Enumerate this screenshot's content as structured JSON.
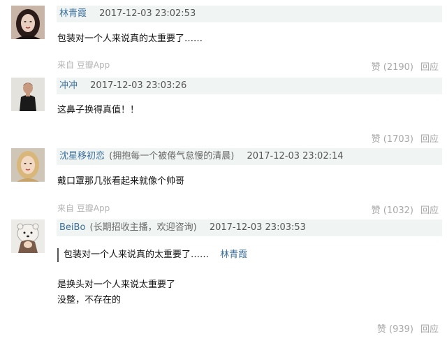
{
  "comments": [
    {
      "user": "林青霞",
      "signature": "",
      "time": "2017-12-03 23:02:53",
      "text_lines": [
        "包装对一个人来说真的太重要了……"
      ],
      "source": "来自 豆瓣App",
      "like_label": "赞 (2190)",
      "reply_label": "回应"
    },
    {
      "user": "冲冲",
      "signature": "",
      "time": "2017-12-03 23:03:26",
      "text_lines": [
        "这鼻子换得真值！！"
      ],
      "source": "",
      "like_label": "赞 (1703)",
      "reply_label": "回应"
    },
    {
      "user": "沈星移初恋",
      "signature": "(拥抱每一个被倦气怠慢的清晨)",
      "time": "2017-12-03 23:02:14",
      "text_lines": [
        "戴口罩那几张看起来就像个帅哥"
      ],
      "source": "来自 豆瓣App",
      "like_label": "赞 (1032)",
      "reply_label": "回应"
    },
    {
      "user": "BeiBo",
      "signature": "(长期招收主播，欢迎咨询)",
      "time": "2017-12-03 23:03:53",
      "quote_text": "包装对一个人来说真的太重要了……",
      "quote_user": "林青霞",
      "text_lines": [
        "是换头对一个人来说太重要了",
        "没整，不存在的"
      ],
      "source": "",
      "like_label": "赞 (939)",
      "reply_label": "回应"
    }
  ]
}
